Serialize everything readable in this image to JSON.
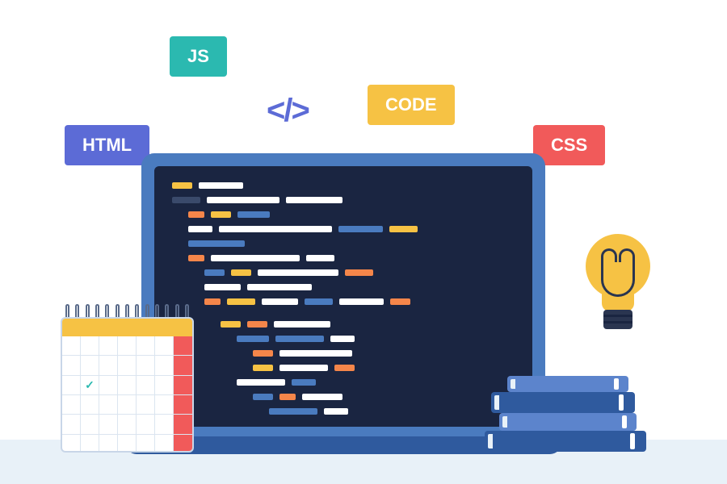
{
  "badges": {
    "js": "JS",
    "html": "HTML",
    "code": "CODE",
    "css": "CSS"
  },
  "glyph": "</>",
  "calendar": {
    "check_mark": "✓"
  }
}
